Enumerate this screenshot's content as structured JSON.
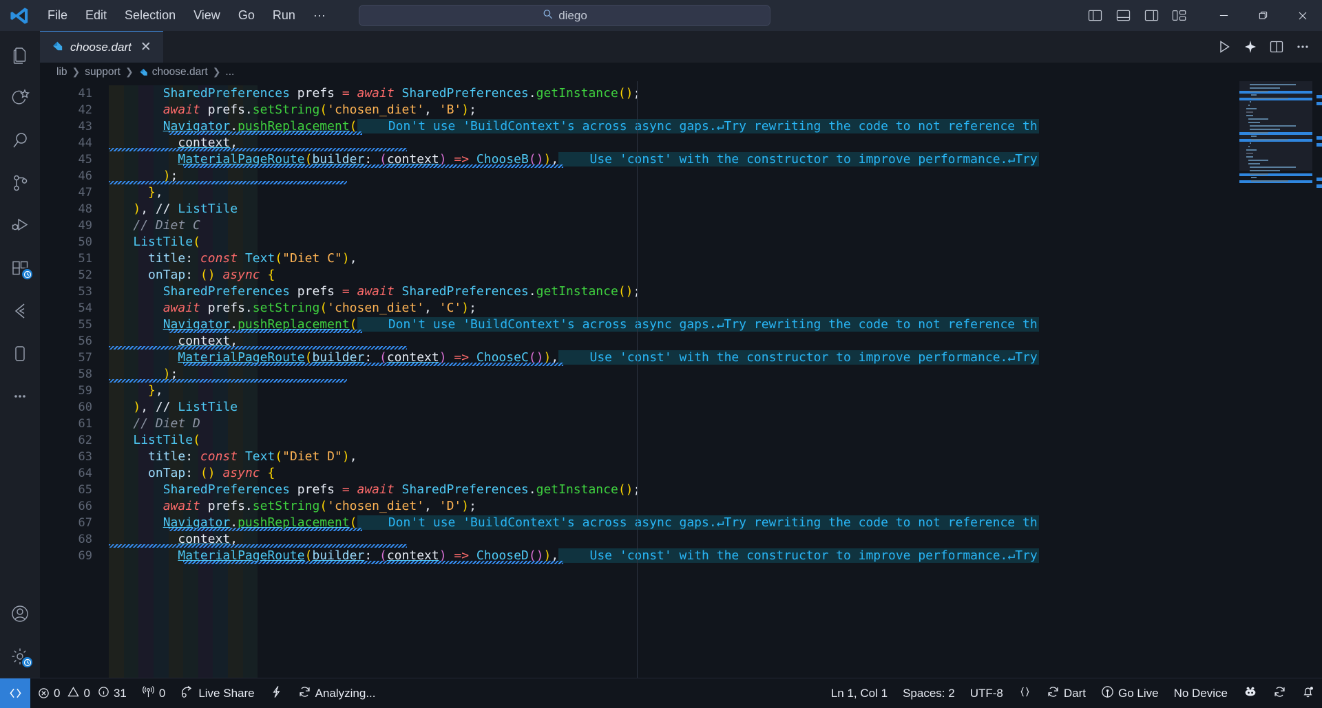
{
  "titlebar": {
    "logo_icon": "vscode-logo-icon",
    "menus": [
      "File",
      "Edit",
      "Selection",
      "View",
      "Go",
      "Run",
      "···"
    ],
    "nav_back_icon": "arrow-left-icon",
    "nav_forward_icon": "arrow-right-icon",
    "search": {
      "icon": "search-icon",
      "value": "diego",
      "placeholder": "Search"
    },
    "layout_icons": [
      "toggle-primary-sidebar-icon",
      "toggle-panel-icon",
      "toggle-secondary-sidebar-icon",
      "customize-layout-icon"
    ],
    "window_controls": [
      "minimize-icon",
      "restore-icon",
      "close-icon"
    ]
  },
  "activitybar": {
    "items": [
      {
        "name": "explorer",
        "icon": "files-icon",
        "badge": ""
      },
      {
        "name": "copilot",
        "icon": "moon-star-icon",
        "badge": ""
      },
      {
        "name": "search",
        "icon": "search-icon",
        "badge": ""
      },
      {
        "name": "source-control",
        "icon": "source-control-icon",
        "badge": ""
      },
      {
        "name": "run-and-debug",
        "icon": "run-debug-icon",
        "badge": ""
      },
      {
        "name": "extensions",
        "icon": "extensions-icon",
        "badge": "clock"
      },
      {
        "name": "flutter",
        "icon": "flutter-icon",
        "badge": ""
      },
      {
        "name": "device-preview",
        "icon": "phone-icon",
        "badge": ""
      },
      {
        "name": "additional-views",
        "icon": "ellipsis-icon",
        "badge": ""
      }
    ],
    "bottom_items": [
      {
        "name": "accounts",
        "icon": "account-icon"
      },
      {
        "name": "settings",
        "icon": "gear-icon",
        "badge": "clock"
      }
    ]
  },
  "tabs": [
    {
      "label": "choose.dart",
      "icon": "dart-file-icon",
      "close_icon": "close-icon",
      "active": true
    }
  ],
  "editor_actions": [
    {
      "name": "run-button",
      "icon": "play-icon"
    },
    {
      "name": "copilot-button",
      "icon": "sparkle-icon"
    },
    {
      "name": "split-editor-button",
      "icon": "split-editor-icon"
    },
    {
      "name": "more-actions-button",
      "icon": "ellipsis-icon"
    }
  ],
  "breadcrumbs": [
    "lib",
    "support",
    "choose.dart",
    "..."
  ],
  "editor": {
    "first_line": 41,
    "lines": [
      {
        "n": 41,
        "indent": 8,
        "text": "SharedPreferences prefs = await SharedPreferences.getInstance();"
      },
      {
        "n": 42,
        "indent": 8,
        "text": "await prefs.setString('chosen_diet', 'B');"
      },
      {
        "n": 43,
        "indent": 8,
        "text": "Navigator.pushReplacement(",
        "hint": "Don't use 'BuildContext's across async gaps.↵Try rewriting the code to not reference th"
      },
      {
        "n": 44,
        "indent": 10,
        "text": "context,"
      },
      {
        "n": 45,
        "indent": 10,
        "text": "MaterialPageRoute(builder: (context) => ChooseB()),",
        "hint": "Use 'const' with the constructor to improve performance.↵Try"
      },
      {
        "n": 46,
        "indent": 8,
        "text": ");"
      },
      {
        "n": 47,
        "indent": 6,
        "text": "},"
      },
      {
        "n": 48,
        "indent": 4,
        "text": "), // ListTile"
      },
      {
        "n": 49,
        "indent": 4,
        "text": "// Diet C"
      },
      {
        "n": 50,
        "indent": 4,
        "text": "ListTile("
      },
      {
        "n": 51,
        "indent": 6,
        "text": "title: const Text(\"Diet C\"),"
      },
      {
        "n": 52,
        "indent": 6,
        "text": "onTap: () async {"
      },
      {
        "n": 53,
        "indent": 8,
        "text": "SharedPreferences prefs = await SharedPreferences.getInstance();"
      },
      {
        "n": 54,
        "indent": 8,
        "text": "await prefs.setString('chosen_diet', 'C');"
      },
      {
        "n": 55,
        "indent": 8,
        "text": "Navigator.pushReplacement(",
        "hint": "Don't use 'BuildContext's across async gaps.↵Try rewriting the code to not reference th"
      },
      {
        "n": 56,
        "indent": 10,
        "text": "context,"
      },
      {
        "n": 57,
        "indent": 10,
        "text": "MaterialPageRoute(builder: (context) => ChooseC()),",
        "hint": "Use 'const' with the constructor to improve performance.↵Try"
      },
      {
        "n": 58,
        "indent": 8,
        "text": ");"
      },
      {
        "n": 59,
        "indent": 6,
        "text": "},"
      },
      {
        "n": 60,
        "indent": 4,
        "text": "), // ListTile"
      },
      {
        "n": 61,
        "indent": 4,
        "text": "// Diet D"
      },
      {
        "n": 62,
        "indent": 4,
        "text": "ListTile("
      },
      {
        "n": 63,
        "indent": 6,
        "text": "title: const Text(\"Diet D\"),"
      },
      {
        "n": 64,
        "indent": 6,
        "text": "onTap: () async {"
      },
      {
        "n": 65,
        "indent": 8,
        "text": "SharedPreferences prefs = await SharedPreferences.getInstance();"
      },
      {
        "n": 66,
        "indent": 8,
        "text": "await prefs.setString('chosen_diet', 'D');"
      },
      {
        "n": 67,
        "indent": 8,
        "text": "Navigator.pushReplacement(",
        "hint": "Don't use 'BuildContext's across async gaps.↵Try rewriting the code to not reference th"
      },
      {
        "n": 68,
        "indent": 10,
        "text": "context,"
      },
      {
        "n": 69,
        "indent": 10,
        "text": "MaterialPageRoute(builder: (context) => ChooseD()),",
        "hint": "Use 'const' with the constructor to improve performance.↵Try"
      }
    ]
  },
  "statusbar": {
    "remote_icon": "remote-window-icon",
    "left_items": [
      {
        "name": "problems",
        "errors_icon": "error-icon",
        "errors": "0",
        "warnings_icon": "warning-icon",
        "warnings": "0",
        "info_icon": "info-icon",
        "info": "31"
      },
      {
        "name": "ports",
        "icon": "radio-tower-icon",
        "label": "0"
      },
      {
        "name": "live-share",
        "icon": "live-share-icon",
        "label": "Live Share"
      },
      {
        "name": "flutter-hot-reload",
        "icon": "lightning-icon",
        "label": ""
      },
      {
        "name": "analyzing",
        "icon": "sync-icon",
        "label": "Analyzing..."
      }
    ],
    "right_items": [
      {
        "name": "editor-position",
        "label": "Ln 1, Col 1"
      },
      {
        "name": "editor-indentation",
        "label": "Spaces: 2"
      },
      {
        "name": "editor-encoding",
        "label": "UTF-8"
      },
      {
        "name": "editor-language-brackets",
        "icon": "brackets-icon",
        "label": ""
      },
      {
        "name": "editor-language",
        "icon": "sync-icon",
        "label": "Dart"
      },
      {
        "name": "go-live",
        "icon": "broadcast-icon",
        "label": "Go Live"
      },
      {
        "name": "device-selector",
        "label": "No Device"
      },
      {
        "name": "copilot-status",
        "icon": "copilot-icon",
        "label": ""
      },
      {
        "name": "sync-status",
        "icon": "sync-icon",
        "label": ""
      },
      {
        "name": "notifications",
        "icon": "bell-dot-icon",
        "label": ""
      }
    ]
  },
  "colors": {
    "titlebar_bg": "#252b37",
    "editor_bg": "#11151c",
    "activitybar_bg": "#1b1f27",
    "accent": "#2f7fd8",
    "hint_fg": "#29b6f6",
    "hint_bg": "#10333f"
  }
}
